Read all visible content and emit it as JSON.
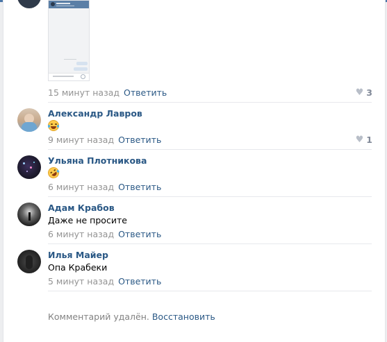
{
  "colors": {
    "accent": "#2a5885",
    "muted": "#939393",
    "page": "#edeef0",
    "topbar": "#4a76a8"
  },
  "first": {
    "time": "15 минут назад",
    "reply": "Ответить",
    "likes": "3"
  },
  "comments": [
    {
      "author": "Александр Лавров",
      "emoji": "face-with-tears-of-joy",
      "text": "",
      "time": "9 минут назад",
      "reply": "Ответить",
      "likes": "1"
    },
    {
      "author": "Ульяна Плотникова",
      "emoji": "rolling-on-floor-laughing",
      "text": "",
      "time": "6 минут назад",
      "reply": "Ответить",
      "likes": ""
    },
    {
      "author": "Адам Крабов",
      "emoji": "",
      "text": "Даже не просите",
      "time": "6 минут назад",
      "reply": "Ответить",
      "likes": ""
    },
    {
      "author": "Илья Майер",
      "emoji": "",
      "text": "Опа Крабеки",
      "time": "5 минут назад",
      "reply": "Ответить",
      "likes": ""
    }
  ],
  "deleted": {
    "text": "Комментарий удалён.",
    "restore": "Восстановить"
  }
}
